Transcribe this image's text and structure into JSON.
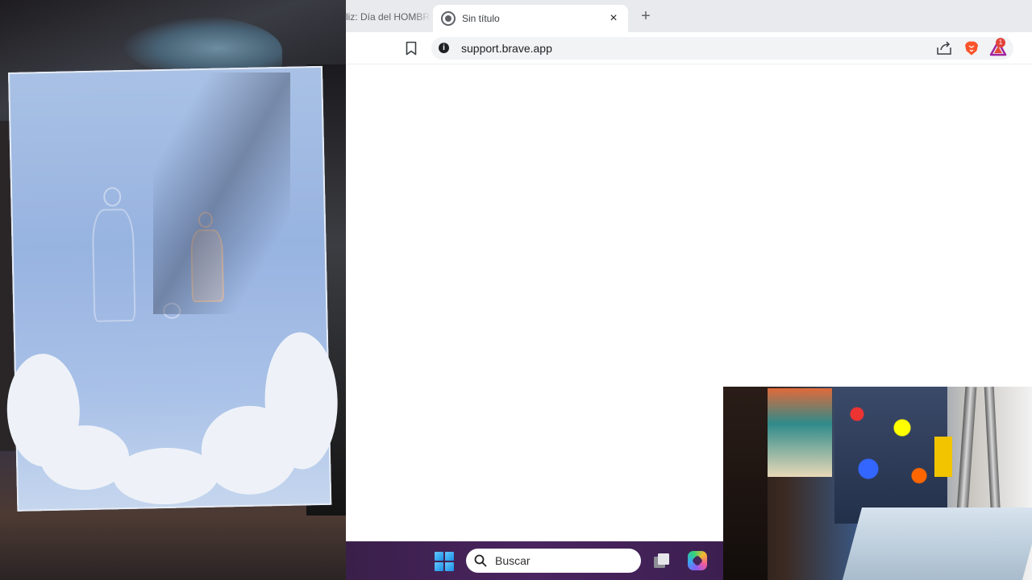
{
  "browser": {
    "tabs": [
      {
        "label": "liz: Día del HOMBRE",
        "active": false
      },
      {
        "label": "Sin título",
        "active": true
      }
    ],
    "new_tab_symbol": "+",
    "close_symbol": "×",
    "address_bar": {
      "url": "support.brave.app"
    },
    "badges": {
      "rewards_count": "1"
    }
  },
  "taskbar": {
    "search_placeholder": "Buscar"
  },
  "icons": {
    "bookmark": "bookmark-icon",
    "site_info": "info-icon",
    "share": "share-icon",
    "brave_shields": "brave-lion-icon",
    "brave_rewards": "rewards-triangle-icon",
    "windows_start": "windows-logo-icon",
    "search": "search-icon",
    "task_view": "task-view-icon",
    "copilot": "copilot-icon"
  },
  "colors": {
    "tabstrip": "#e8eaed",
    "taskbar": "#4a2560",
    "brave_orange": "#fb542b",
    "rewards_red": "#e2433a"
  }
}
